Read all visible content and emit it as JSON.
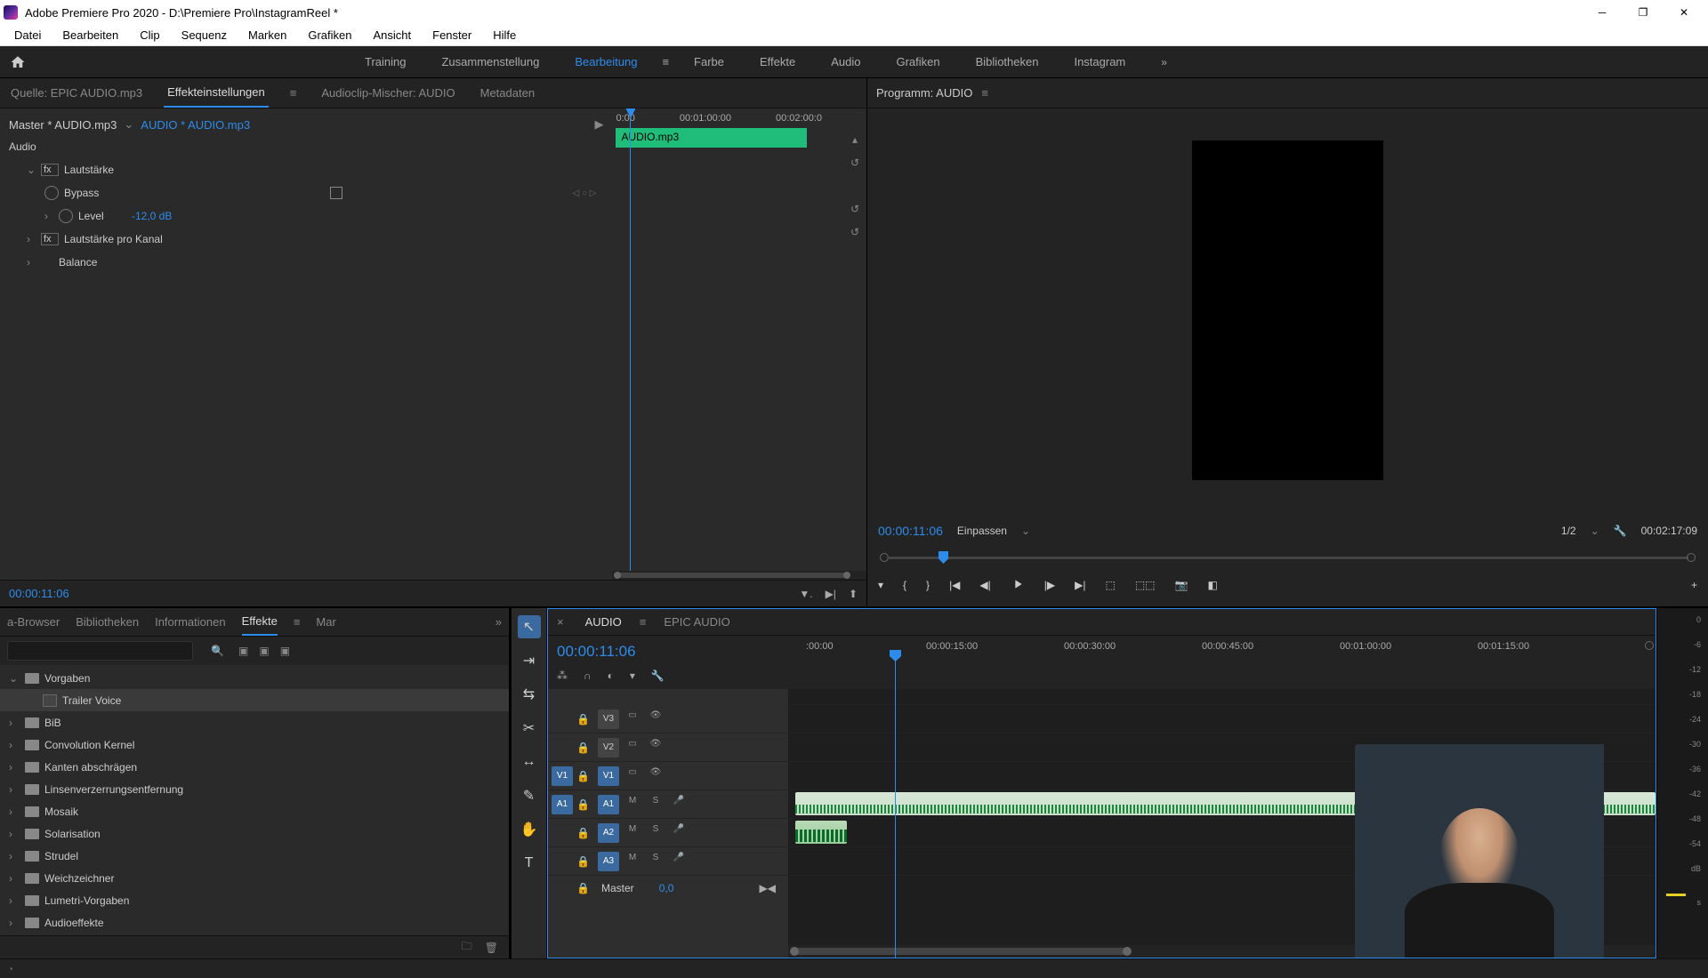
{
  "window": {
    "title": "Adobe Premiere Pro 2020 - D:\\Premiere Pro\\InstagramReel *"
  },
  "menubar": [
    "Datei",
    "Bearbeiten",
    "Clip",
    "Sequenz",
    "Marken",
    "Grafiken",
    "Ansicht",
    "Fenster",
    "Hilfe"
  ],
  "workspaces": {
    "items": [
      "Training",
      "Zusammenstellung",
      "Bearbeitung",
      "Farbe",
      "Effekte",
      "Audio",
      "Grafiken",
      "Bibliotheken",
      "Instagram"
    ],
    "active": "Bearbeitung"
  },
  "source_tabs": {
    "quelle": "Quelle: EPIC AUDIO.mp3",
    "einstellungen": "Effekteinstellungen",
    "mischer": "Audioclip-Mischer: AUDIO",
    "metadaten": "Metadaten"
  },
  "effect_controls": {
    "master": "Master * AUDIO.mp3",
    "clip": "AUDIO * AUDIO.mp3",
    "audio_label": "Audio",
    "lautstaerke": "Lautstärke",
    "bypass": "Bypass",
    "level": "Level",
    "level_value": "-12,0 dB",
    "lautstaerke_kanal": "Lautstärke pro Kanal",
    "balance": "Balance",
    "ruler": {
      "t0": "0:00",
      "t1": "00:01:00:00",
      "t2": "00:02:00:0"
    },
    "clipbar": "AUDIO.mp3",
    "timecode": "00:00:11:06"
  },
  "program": {
    "label": "Programm: AUDIO",
    "timecode": "00:00:11:06",
    "fit": "Einpassen",
    "zoom": "1/2",
    "duration": "00:02:17:09"
  },
  "project": {
    "tabs": {
      "browser": "a-Browser",
      "bibliotheken": "Bibliotheken",
      "informationen": "Informationen",
      "effekte": "Effekte",
      "mar": "Mar"
    },
    "tree": [
      {
        "label": "Vorgaben",
        "type": "folder",
        "expanded": true
      },
      {
        "label": "Trailer Voice",
        "type": "preset",
        "indent": 1,
        "selected": true
      },
      {
        "label": "BiB",
        "type": "folder"
      },
      {
        "label": "Convolution Kernel",
        "type": "folder"
      },
      {
        "label": "Kanten abschrägen",
        "type": "folder"
      },
      {
        "label": "Linsenverzerrungsentfernung",
        "type": "folder"
      },
      {
        "label": "Mosaik",
        "type": "folder"
      },
      {
        "label": "Solarisation",
        "type": "folder"
      },
      {
        "label": "Strudel",
        "type": "folder"
      },
      {
        "label": "Weichzeichner",
        "type": "folder"
      },
      {
        "label": "Lumetri-Vorgaben",
        "type": "folder"
      },
      {
        "label": "Audioeffekte",
        "type": "folder"
      }
    ]
  },
  "timeline": {
    "tabs": {
      "audio": "AUDIO",
      "epic": "EPIC AUDIO"
    },
    "timecode": "00:00:11:06",
    "ruler": {
      "t0": ":00:00",
      "t1": "00:00:15:00",
      "t2": "00:00:30:00",
      "t3": "00:00:45:00",
      "t4": "00:01:00:00",
      "t5": "00:01:15:00"
    },
    "tracks": {
      "v3": "V3",
      "v2": "V2",
      "v1": "V1",
      "a1": "A1",
      "a2": "A2",
      "a3": "A3",
      "src_v1": "V1",
      "src_a1": "A1",
      "m": "M",
      "s": "S",
      "master": "Master",
      "master_val": "0,0"
    }
  },
  "audiometer": {
    "ticks": [
      "0",
      "-6",
      "-12",
      "-18",
      "-24",
      "-30",
      "-36",
      "-42",
      "-48",
      "-54",
      "dB",
      "s"
    ]
  }
}
